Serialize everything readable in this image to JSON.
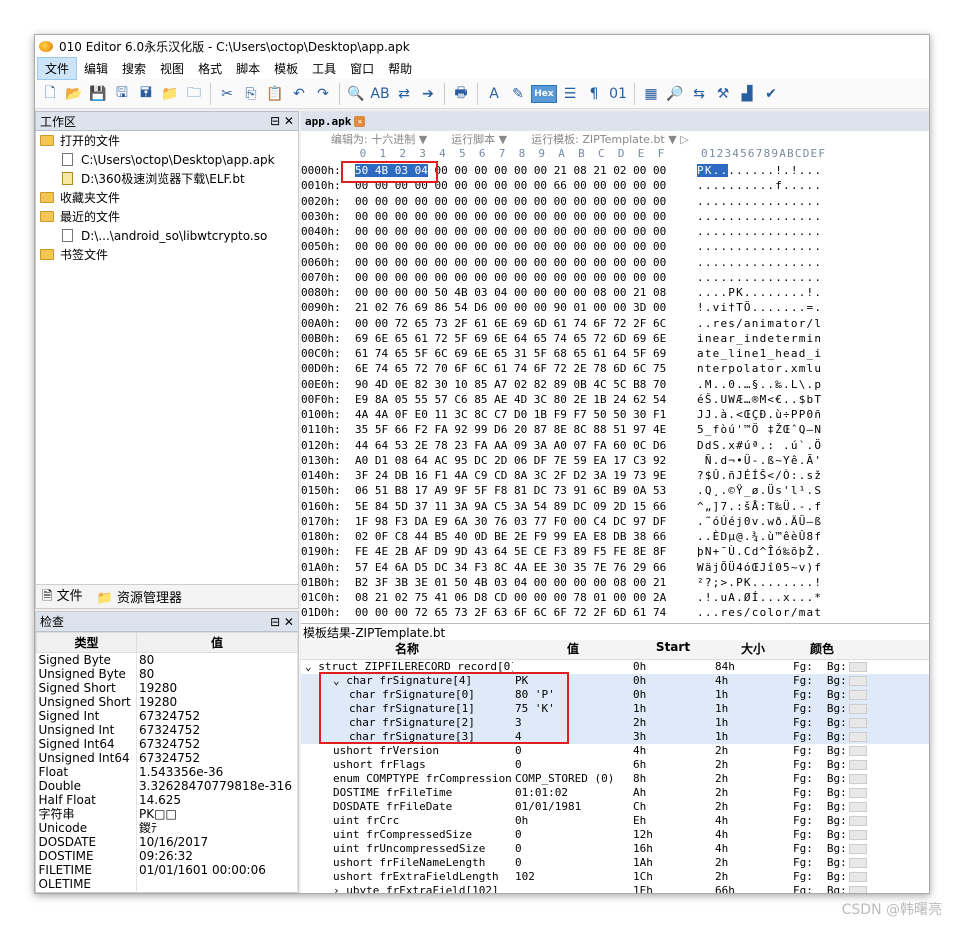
{
  "window": {
    "title": "010 Editor 6.0永乐汉化版 - C:\\Users\\octop\\Desktop\\app.apk"
  },
  "menu": [
    "文件",
    "编辑",
    "搜索",
    "视图",
    "格式",
    "脚本",
    "模板",
    "工具",
    "窗口",
    "帮助"
  ],
  "toolbar": {
    "hex_label": "Hex",
    "icons": [
      "new-file-icon",
      "open-icon",
      "save-icon",
      "save-as-icon",
      "save-all-icon",
      "open-folder-icon",
      "close-icon",
      "cut-icon",
      "copy-icon",
      "paste-icon",
      "undo-icon",
      "redo-icon",
      "find-icon",
      "replace-icon",
      "find-in-files-icon",
      "goto-icon",
      "print-icon",
      "font-icon",
      "highlight-icon",
      "hex-icon",
      "columns-icon",
      "paragraph-icon",
      "binary-icon",
      "calculator-icon",
      "inspector-icon",
      "script-icon",
      "tools-icon",
      "histogram-icon",
      "check-icon"
    ]
  },
  "workspace": {
    "title": "工作区",
    "sections": [
      {
        "label": "打开的文件",
        "type": "folder",
        "indent": 0
      },
      {
        "label": "C:\\Users\\octop\\Desktop\\app.apk",
        "type": "doc",
        "indent": 1
      },
      {
        "label": "D:\\360极速浏览器下载\\ELF.bt",
        "type": "bt",
        "indent": 1
      },
      {
        "label": "收藏夹文件",
        "type": "folder",
        "indent": 0
      },
      {
        "label": "最近的文件",
        "type": "folder",
        "indent": 0
      },
      {
        "label": "D:\\...\\android_so\\libwtcrypto.so",
        "type": "doc",
        "indent": 1
      },
      {
        "label": "书签文件",
        "type": "folder",
        "indent": 0
      }
    ],
    "tabs": [
      "文件",
      "资源管理器"
    ]
  },
  "inspector": {
    "title": "检查",
    "col_type": "类型",
    "col_value": "值",
    "rows": [
      [
        "Signed Byte",
        "80"
      ],
      [
        "Unsigned Byte",
        "80"
      ],
      [
        "Signed Short",
        "19280"
      ],
      [
        "Unsigned Short",
        "19280"
      ],
      [
        "Signed Int",
        "67324752"
      ],
      [
        "Unsigned Int",
        "67324752"
      ],
      [
        "Signed Int64",
        "67324752"
      ],
      [
        "Unsigned Int64",
        "67324752"
      ],
      [
        "Float",
        "1.543356e-36"
      ],
      [
        "Double",
        "3.32628470779818e-316"
      ],
      [
        "Half Float",
        "14.625"
      ],
      [
        "字符串",
        "PK□□"
      ],
      [
        "Unicode",
        "鍐ﾃ"
      ],
      [
        "DOSDATE",
        "10/16/2017"
      ],
      [
        "DOSTIME",
        "09:26:32"
      ],
      [
        "FILETIME",
        "01/01/1601 00:00:06"
      ],
      [
        "OLETIME",
        ""
      ]
    ]
  },
  "editor": {
    "tab": "app.apk",
    "editas": "编辑为: 十六进制 ▼",
    "runscript": "运行脚本 ▼",
    "runtemplate": "运行模板: ZIPTemplate.bt ▼ ▷",
    "hexcols": " 0  1  2  3  4  5  6  7  8  9  A  B  C  D  E  F",
    "asccols": "0123456789ABCDEF",
    "rows": [
      [
        "0000h:",
        "50 4B 03 04 00 00 00 00 00 00 21 08 21 02 00 00",
        "PK........!.!..."
      ],
      [
        "0010h:",
        "00 00 00 00 00 00 00 00 00 00 66 00 00 00 00 00",
        "..........f....."
      ],
      [
        "0020h:",
        "00 00 00 00 00 00 00 00 00 00 00 00 00 00 00 00",
        "................"
      ],
      [
        "0030h:",
        "00 00 00 00 00 00 00 00 00 00 00 00 00 00 00 00",
        "................"
      ],
      [
        "0040h:",
        "00 00 00 00 00 00 00 00 00 00 00 00 00 00 00 00",
        "................"
      ],
      [
        "0050h:",
        "00 00 00 00 00 00 00 00 00 00 00 00 00 00 00 00",
        "................"
      ],
      [
        "0060h:",
        "00 00 00 00 00 00 00 00 00 00 00 00 00 00 00 00",
        "................"
      ],
      [
        "0070h:",
        "00 00 00 00 00 00 00 00 00 00 00 00 00 00 00 00",
        "................"
      ],
      [
        "0080h:",
        "00 00 00 00 50 4B 03 04 00 00 00 00 08 00 21 08",
        "....PK........!."
      ],
      [
        "0090h:",
        "21 02 76 69 86 54 D6 00 00 00 90 01 00 00 3D 00",
        "!.vi†TÖ.......=."
      ],
      [
        "00A0h:",
        "00 00 72 65 73 2F 61 6E 69 6D 61 74 6F 72 2F 6C",
        "..res/animator/l"
      ],
      [
        "00B0h:",
        "69 6E 65 61 72 5F 69 6E 64 65 74 65 72 6D 69 6E",
        "inear_indetermin"
      ],
      [
        "00C0h:",
        "61 74 65 5F 6C 69 6E 65 31 5F 68 65 61 64 5F 69",
        "ate_line1_head_i"
      ],
      [
        "00D0h:",
        "6E 74 65 72 70 6F 6C 61 74 6F 72 2E 78 6D 6C 75",
        "nterpolator.xmlu"
      ],
      [
        "00E0h:",
        "90 4D 0E 82 30 10 85 A7 02 82 89 0B 4C 5C B8 70",
        ".M..0.…§..‰.L\\.p"
      ],
      [
        "00F0h:",
        "E9 8A 05 55 57 C6 85 AE 4D 3C 80 2E 1B 24 62 54",
        "éŠ.UWÆ…®M<€..$bT"
      ],
      [
        "0100h:",
        "4A 4A 0F E0 11 3C 8C C7 D0 1B F9 F7 50 50 30 F1",
        "JJ.à.<ŒÇÐ.ù÷PP0ñ"
      ],
      [
        "0110h:",
        "35 5F 66 F2 FA 92 99 D6 20 87 8E 8C 88 51 97 4E",
        "5_fòú'™Ö ‡ŽŒˆQ—N"
      ],
      [
        "0120h:",
        "44 64 53 2E 78 23 FA AA 09 3A A0 07 FA 60 0C D6",
        "DdS.x#úª.: .ú`.Ö"
      ],
      [
        "0130h:",
        "A0 D1 08 64 AC 95 DC 2D 06 DF 7E 59 EA 17 C3 92",
        " Ñ.d¬•Ü-.ß~Yê.Ã'"
      ],
      [
        "0140h:",
        "3F 24 DB 16 F1 4A C9 CD 8A 3C 2F D2 3A 19 73 9E",
        "?$Û.ñJÉÍŠ</Ò:.sž"
      ],
      [
        "0150h:",
        "06 51 B8 17 A9 9F 5F F8 81 DC 73 91 6C B9 0A 53",
        ".Q¸.©Ÿ_ø.Üs'l¹.S"
      ],
      [
        "0160h:",
        "5E 84 5D 37 11 3A 9A C5 3A 54 89 DC 09 2D 15 66",
        "^„]7.:šÅ:T‰Ü.-.f"
      ],
      [
        "0170h:",
        "1F 98 F3 DA E9 6A 30 76 03 77 F0 00 C4 DC 97 DF",
        ".˜óÚéj0v.wð.ÄÜ—ß"
      ],
      [
        "0180h:",
        "02 0F C8 44 B5 40 0D BE 2E F9 99 EA E8 DB 38 66",
        "..ÈDµ@.¾.ù™êèÛ8f"
      ],
      [
        "0190h:",
        "FE 4E 2B AF D9 9D 43 64 5E CE F3 89 F5 FE 8E 8F",
        "þN+¯Ù.Cd^Îó‰õþŽ."
      ],
      [
        "01A0h:",
        "57 E4 6A D5 DC 34 F3 8C 4A EE 30 35 7E 76 29 66",
        "WäjÕÜ4óŒJî05~v)f"
      ],
      [
        "01B0h:",
        "B2 3F 3B 3E 01 50 4B 03 04 00 00 00 00 08 00 21",
        "²?;>.PK........!"
      ],
      [
        "01C0h:",
        "08 21 02 75 41 06 D8 CD 00 00 00 78 01 00 00 2A",
        ".!.uA.ØÍ...x...*"
      ],
      [
        "01D0h:",
        "00 00 00 72 65 73 2F 63 6F 6C 6F 72 2F 6D 61 74",
        "...res/color/mat"
      ]
    ]
  },
  "template": {
    "title": "模板结果-ZIPTemplate.bt",
    "headers": [
      "名称",
      "值",
      "Start",
      "大小",
      "颜色"
    ],
    "rows": [
      [
        "struct ZIPFILERECORD record[0]",
        "",
        "0h",
        "84h",
        "Fg:",
        "Bg:",
        0,
        false
      ],
      [
        "char frSignature[4]",
        "PK",
        "0h",
        "4h",
        "Fg:",
        "Bg:",
        1,
        true
      ],
      [
        "char frSignature[0]",
        "80 'P'",
        "0h",
        "1h",
        "Fg:",
        "Bg:",
        2,
        true
      ],
      [
        "char frSignature[1]",
        "75 'K'",
        "1h",
        "1h",
        "Fg:",
        "Bg:",
        2,
        true
      ],
      [
        "char frSignature[2]",
        "3",
        "2h",
        "1h",
        "Fg:",
        "Bg:",
        2,
        true
      ],
      [
        "char frSignature[3]",
        "4",
        "3h",
        "1h",
        "Fg:",
        "Bg:",
        2,
        true
      ],
      [
        "ushort frVersion",
        "0",
        "4h",
        "2h",
        "Fg:",
        "Bg:",
        1,
        false
      ],
      [
        "ushort frFlags",
        "0",
        "6h",
        "2h",
        "Fg:",
        "Bg:",
        1,
        false
      ],
      [
        "enum COMPTYPE frCompression",
        "COMP_STORED (0)",
        "8h",
        "2h",
        "Fg:",
        "Bg:",
        1,
        false
      ],
      [
        "DOSTIME frFileTime",
        "01:01:02",
        "Ah",
        "2h",
        "Fg:",
        "Bg:",
        1,
        false
      ],
      [
        "DOSDATE frFileDate",
        "01/01/1981",
        "Ch",
        "2h",
        "Fg:",
        "Bg:",
        1,
        false
      ],
      [
        "uint frCrc",
        "0h",
        "Eh",
        "4h",
        "Fg:",
        "Bg:",
        1,
        false
      ],
      [
        "uint frCompressedSize",
        "0",
        "12h",
        "4h",
        "Fg:",
        "Bg:",
        1,
        false
      ],
      [
        "uint frUncompressedSize",
        "0",
        "16h",
        "4h",
        "Fg:",
        "Bg:",
        1,
        false
      ],
      [
        "ushort frFileNameLength",
        "0",
        "1Ah",
        "2h",
        "Fg:",
        "Bg:",
        1,
        false
      ],
      [
        "ushort frExtraFieldLength",
        "102",
        "1Ch",
        "2h",
        "Fg:",
        "Bg:",
        1,
        false
      ],
      [
        "ubyte frExtraField[102]",
        "",
        "1Eh",
        "66h",
        "Fg:",
        "Bg:",
        1,
        false
      ]
    ]
  },
  "watermark": "CSDN @韩曙亮"
}
